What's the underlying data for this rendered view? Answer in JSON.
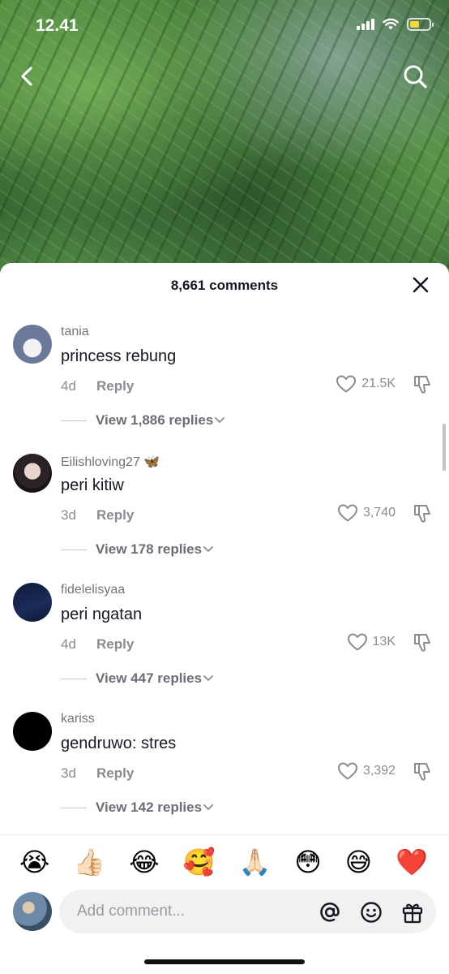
{
  "status_bar": {
    "time": "12.41"
  },
  "video": {
    "back_icon": "chevron-left-icon",
    "search_icon": "search-icon"
  },
  "comments_panel": {
    "title": "8,661 comments",
    "close_icon": "close-icon",
    "comments": [
      {
        "username": "tania",
        "badge": "",
        "text": "princess rebung",
        "age": "4d",
        "reply": "Reply",
        "likes": "21.5K",
        "view_replies": "View 1,886 replies"
      },
      {
        "username": "Eilishloving27",
        "badge": "🦋",
        "text": "peri kitiw",
        "age": "3d",
        "reply": "Reply",
        "likes": "3,740",
        "view_replies": "View 178 replies"
      },
      {
        "username": "fidelelisyaa",
        "badge": "",
        "text": "peri ngatan",
        "age": "4d",
        "reply": "Reply",
        "likes": "13K",
        "view_replies": "View 447 replies"
      },
      {
        "username": "kariss",
        "badge": "",
        "text": "gendruwo: stres",
        "age": "3d",
        "reply": "Reply",
        "likes": "3,392",
        "view_replies": "View 142 replies"
      }
    ]
  },
  "emoji_bar": [
    "😭",
    "👍🏻",
    "😂",
    "🥰",
    "🙏🏻",
    "😳",
    "😅",
    "❤️"
  ],
  "composer": {
    "placeholder": "Add comment...",
    "icons": [
      "at-icon",
      "smile-icon",
      "gift-icon"
    ]
  }
}
